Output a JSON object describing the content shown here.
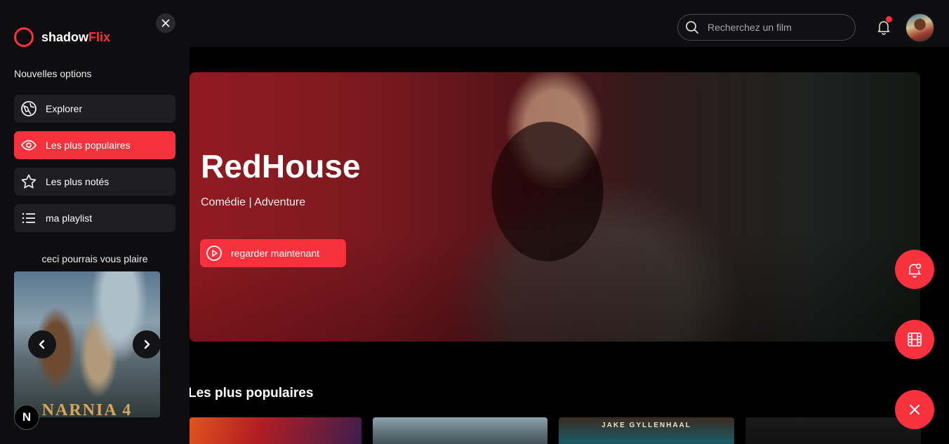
{
  "brand": {
    "name_part1": "shadow",
    "name_part2": "Flix",
    "accent": "#f8313e"
  },
  "header": {
    "search_placeholder": "Recherchez un film",
    "notification_dot": true
  },
  "sidebar": {
    "heading": "Nouvelles options",
    "items": [
      {
        "label": "Explorer",
        "icon": "compass-icon",
        "active": false
      },
      {
        "label": "Les plus populaires",
        "icon": "eye-icon",
        "active": true
      },
      {
        "label": "Les plus notés",
        "icon": "star-icon",
        "active": false
      },
      {
        "label": "ma playlist",
        "icon": "list-icon",
        "active": false
      }
    ],
    "suggestion_title": "ceci pourrais vous plaire",
    "suggestion_poster_text": "NARNIA 4",
    "badge": "N"
  },
  "hero": {
    "title": "RedHouse",
    "genres": "Comédie | Adventure",
    "watch_label": "regarder maintenant"
  },
  "popular": {
    "title": "Les plus populaires",
    "cards": [
      {
        "caption": ""
      },
      {
        "caption": ""
      },
      {
        "caption": "JAKE GYLLENHAAL"
      },
      {
        "caption": ""
      }
    ]
  },
  "fabs": [
    "bell-plus-icon",
    "film-icon",
    "close-icon"
  ]
}
